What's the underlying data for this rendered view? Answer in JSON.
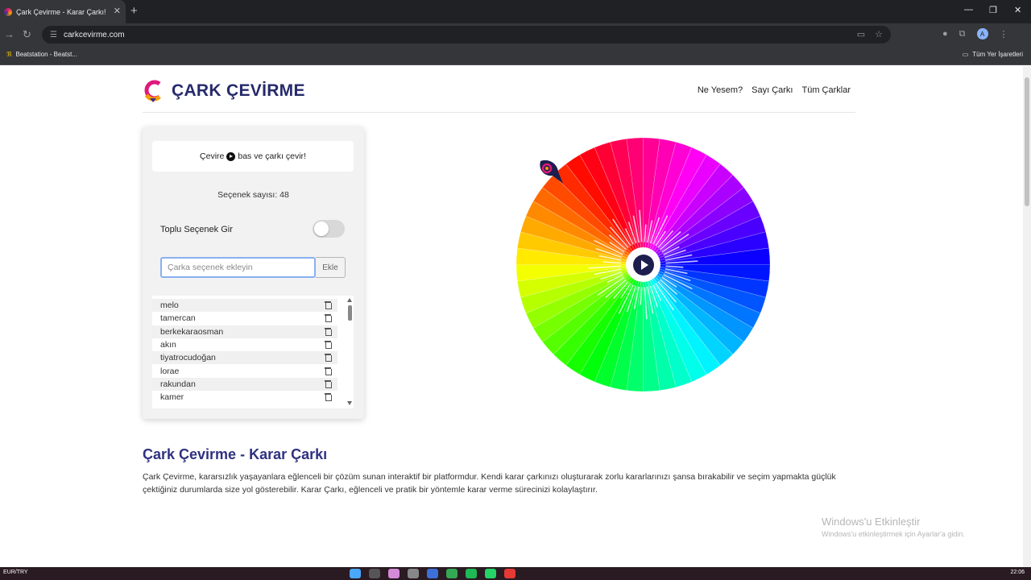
{
  "browser": {
    "tab_title": "Çark Çevirme - Karar Çarkı!",
    "tab_close": "✕",
    "new_tab": "+",
    "url": "carkcevirme.com",
    "bookmark": "Beatstation - Beatst...",
    "all_bookmarks": "Tüm Yer İşaretleri",
    "profile_letter": "A"
  },
  "header": {
    "logo_text": "ÇARK ÇEVİRME",
    "nav": [
      "Ne Yesem?",
      "Sayı Çarkı",
      "Tüm Çarklar"
    ]
  },
  "panel": {
    "hint_before": "Çevire",
    "hint_after": "bas ve çarkı çevir!",
    "option_count": "Seçenek sayısı: 48",
    "bulk_label": "Toplu Seçenek Gir",
    "bulk_enabled": false,
    "input_placeholder": "Çarka seçenek ekleyin",
    "add_label": "Ekle",
    "items": [
      "melo",
      "tamercan",
      "berkekaraosman",
      "akın",
      "tiyatrocudoğan",
      "lorae",
      "rakundan",
      "kamer"
    ]
  },
  "wheel": {
    "segments": 48,
    "colors_description": "rainbow hue sweep"
  },
  "article": {
    "title": "Çark Çevirme - Karar Çarkı",
    "body": "Çark Çevirme, kararsızlık yaşayanlara eğlenceli bir çözüm sunan interaktif bir platformdur. Kendi karar çarkınızı oluşturarak zorlu kararlarınızı şansa bırakabilir ve seçim yapmakta güçlük çektiğiniz durumlarda size yol gösterebilir. Karar Çarkı, eğlenceli ve pratik bir yöntemle karar verme sürecinizi kolaylaştırır."
  },
  "watermark": {
    "line1": "Windows'u Etkinleştir",
    "line2": "Windows'u etkinleştirmek için Ayarlar'a gidin."
  },
  "taskbar": {
    "currency": "EUR/TRY",
    "time": "22:06"
  }
}
